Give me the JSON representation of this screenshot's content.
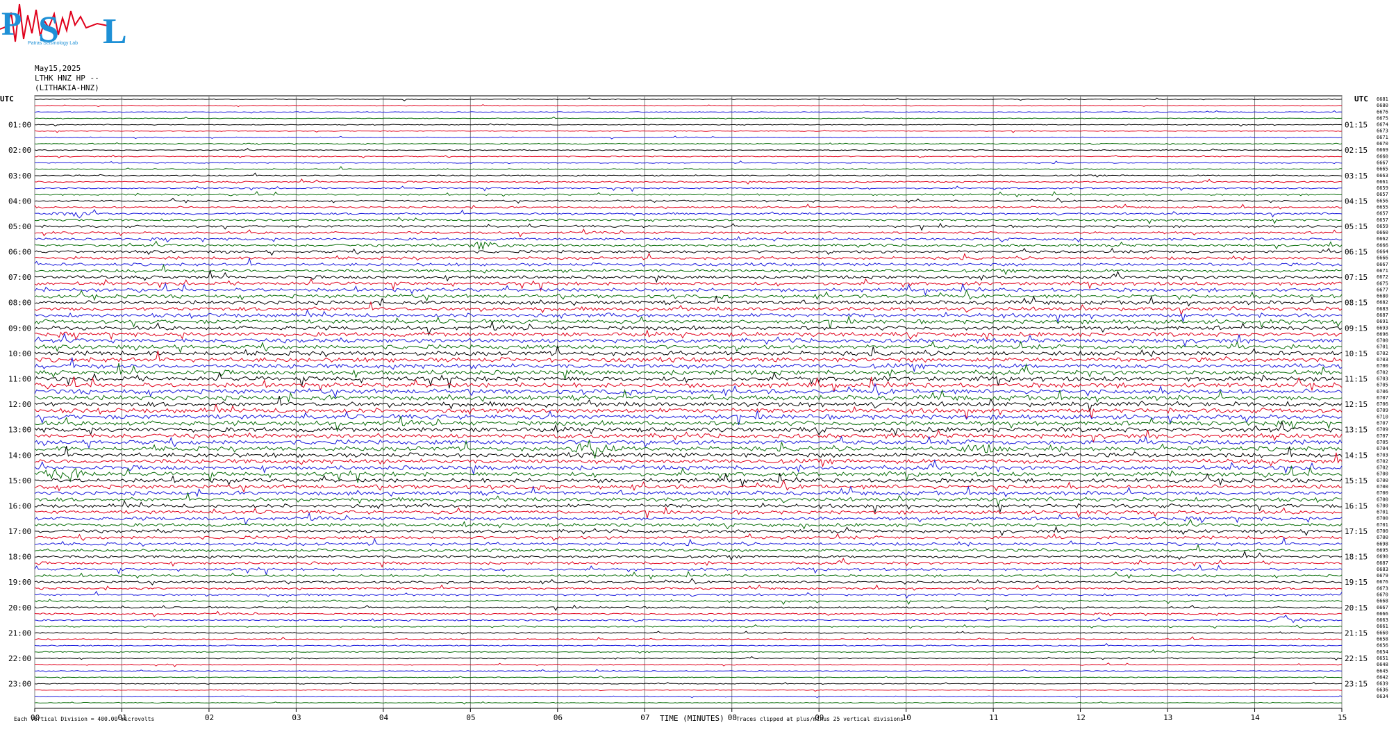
{
  "logo": {
    "letters": "PSL",
    "text": "Patras Seismology Lab"
  },
  "header": {
    "date": "May15,2025",
    "station": "LTHK HNZ HP --",
    "location": "(LITHAKIA-HNZ)"
  },
  "colors": {
    "black": "#000000",
    "red": "#e0001b",
    "blue": "#1a1adc",
    "green": "#0a6e0a",
    "grid": "#7f7f7f"
  },
  "chart_data": {
    "type": "line",
    "left_axis_title": "UTC",
    "right_axis_title": "UTC",
    "left_hour_labels": [
      "01:00",
      "02:00",
      "03:00",
      "04:00",
      "05:00",
      "06:00",
      "07:00",
      "08:00",
      "09:00",
      "10:00",
      "11:00",
      "12:00",
      "13:00",
      "14:00",
      "15:00",
      "16:00",
      "17:00",
      "18:00",
      "19:00",
      "20:00",
      "21:00",
      "22:00",
      "23:00"
    ],
    "right_hour_labels": [
      "01:15",
      "02:15",
      "03:15",
      "04:15",
      "05:15",
      "06:15",
      "07:15",
      "08:15",
      "09:15",
      "10:15",
      "11:15",
      "12:15",
      "13:15",
      "14:15",
      "15:15",
      "16:15",
      "17:15",
      "18:15",
      "19:15",
      "20:15",
      "21:15",
      "22:15",
      "23:15"
    ],
    "x_ticks": [
      "00",
      "01",
      "02",
      "03",
      "04",
      "05",
      "06",
      "07",
      "08",
      "09",
      "10",
      "11",
      "12",
      "13",
      "14",
      "15"
    ],
    "xlim": [
      0,
      15
    ],
    "xlabel": "TIME (MINUTES)",
    "trace_count": 96,
    "trace_color_cycle": [
      "black",
      "red",
      "blue",
      "green"
    ],
    "grid": true,
    "trace_offsets": [
      6681,
      6680,
      6676,
      6675,
      6674,
      6673,
      6671,
      6670,
      6669,
      6660,
      6667,
      6665,
      6663,
      6661,
      6659,
      6657,
      6656,
      6655,
      6657,
      6657,
      6659,
      6660,
      6662,
      6666,
      6664,
      6666,
      6667,
      6671,
      6672,
      6675,
      6677,
      6680,
      6682,
      6683,
      6687,
      6691,
      6693,
      6696,
      6700,
      6701,
      6702,
      6703,
      6700,
      6702,
      6703,
      6705,
      6706,
      6707,
      6706,
      6709,
      6710,
      6707,
      6709,
      6707,
      6705,
      6704,
      6703,
      6702,
      6702,
      6700,
      6700,
      6700,
      6700,
      6700,
      6700,
      6701,
      6700,
      6701,
      6700,
      6700,
      6698,
      6695,
      6690,
      6687,
      6683,
      6679,
      6676,
      6673,
      6670,
      6668,
      6667,
      6666,
      6663,
      6661,
      6660,
      6658,
      6656,
      6654,
      6651,
      6648,
      6645,
      6642,
      6639,
      6636,
      6634
    ],
    "events": [
      {
        "trace": 59,
        "minute": 0.38,
        "amplitude": "large"
      },
      {
        "trace": 55,
        "minute": 6.42,
        "amplitude": "large"
      },
      {
        "trace": 55,
        "minute": 10.85,
        "amplitude": "medium"
      },
      {
        "trace": 23,
        "minute": 5.15,
        "amplitude": "medium"
      },
      {
        "trace": 18,
        "minute": 0.52,
        "amplitude": "medium"
      },
      {
        "trace": 82,
        "minute": 14.35,
        "amplitude": "medium"
      }
    ]
  },
  "footer": {
    "scale_note": "Each Vertical Division =  400.00 microvolts",
    "clip_note": "Traces clipped at plus/minus 25 vertical divisions"
  }
}
